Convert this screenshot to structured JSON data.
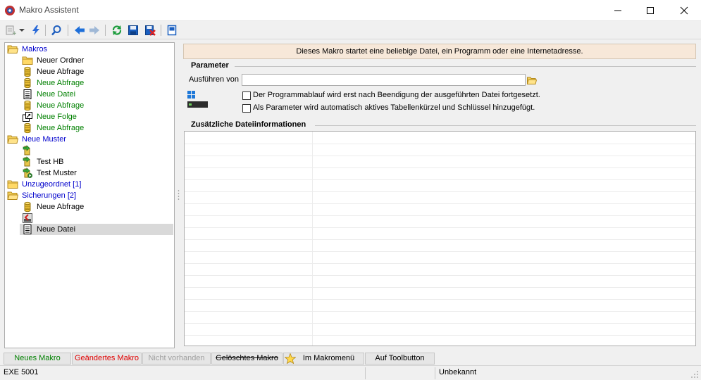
{
  "window": {
    "title": "Makro Assistent",
    "icon": "gear-app-icon"
  },
  "toolbar": {
    "buttons": [
      {
        "name": "new-item-icon"
      },
      {
        "name": "dropdown-arrow-icon"
      },
      {
        "name": "lightning-icon"
      },
      {
        "name": "search-icon"
      },
      {
        "name": "arrow-left-icon"
      },
      {
        "name": "arrow-right-icon"
      },
      {
        "name": "refresh-icon"
      },
      {
        "name": "save-icon"
      },
      {
        "name": "delete-icon"
      },
      {
        "name": "screen-icon"
      }
    ]
  },
  "tree": {
    "items": [
      {
        "label": "Makros",
        "icon": "folder-open-icon",
        "color": "#0000cc"
      },
      {
        "label": "Neuer Ordner",
        "icon": "folder-icon",
        "color": "#000000"
      },
      {
        "label": "Neue Abfrage",
        "icon": "database-icon",
        "color": "#000000"
      },
      {
        "label": "Neue Abfrage",
        "icon": "database-icon",
        "color": "#008000"
      },
      {
        "label": "Neue Datei",
        "icon": "document-icon",
        "color": "#008000"
      },
      {
        "label": "Neue Abfrage",
        "icon": "database-icon",
        "color": "#008000"
      },
      {
        "label": "Neue Folge",
        "icon": "sequence-icon",
        "color": "#008000"
      },
      {
        "label": "Neue Abfrage",
        "icon": "database-icon",
        "color": "#008000"
      },
      {
        "label": "Neue Muster",
        "icon": "folder-open-icon",
        "color": "#0000cc"
      },
      {
        "label": "",
        "icon": "pattern-icon",
        "color": "#000000"
      },
      {
        "label": "Test HB",
        "icon": "pattern-icon",
        "color": "#000000"
      },
      {
        "label": "Test Muster",
        "icon": "pattern-run-icon",
        "color": "#000000"
      },
      {
        "label": "Unzugeordnet [1]",
        "icon": "folder-icon",
        "color": "#0000cc"
      },
      {
        "label": "Sicherungen [2]",
        "icon": "folder-open-icon",
        "color": "#0000cc"
      },
      {
        "label": "Neue Abfrage",
        "icon": "database-icon",
        "color": "#000000"
      },
      {
        "label": "",
        "icon": "backup-icon",
        "color": "#000000"
      },
      {
        "label": "Neue Datei",
        "icon": "document-icon",
        "color": "#000000"
      }
    ]
  },
  "main": {
    "description": "Dieses Makro startet eine beliebige Datei, ein Programm oder eine Internetadresse.",
    "parameter_group": "Parameter",
    "execute_label": "Ausführen von",
    "execute_value": "",
    "checkbox1": {
      "label": "Der Programmablauf wird erst nach Beendigung der ausgeführten Datei fortgesetzt.",
      "checked": false
    },
    "checkbox2": {
      "label": "Als Parameter wird automatisch aktives Tabellenkürzel und Schlüssel hinzugefügt.",
      "checked": false
    },
    "info_group": "Zusätzliche Dateiinformationen"
  },
  "legend": {
    "items": [
      {
        "label": "Neues Makro",
        "color": "#008000"
      },
      {
        "label": "Geändertes Makro",
        "color": "#e00000"
      },
      {
        "label": "Nicht vorhanden",
        "color": "#a0a0a0"
      },
      {
        "label": "Gelöschtes Makro",
        "color": "#000000"
      },
      {
        "label": "Im Makromenü",
        "color": "#000000"
      },
      {
        "label": "Auf Toolbutton",
        "color": "#000000"
      }
    ]
  },
  "status": {
    "left": "EXE 5001",
    "right": "Unbekannt"
  }
}
